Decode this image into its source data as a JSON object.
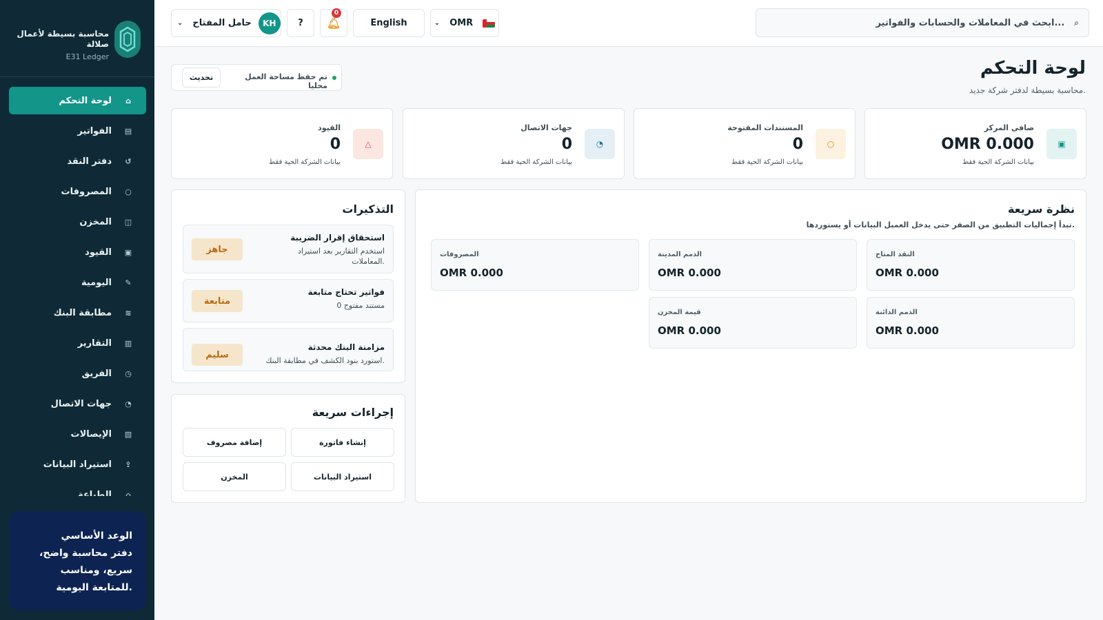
{
  "brand": {
    "name": "محاسبة بسيطة لأعمال صلالة",
    "product": "E31 Ledger"
  },
  "sidebar": {
    "items": [
      {
        "label": "لوحة التحكم",
        "icon": "home-icon",
        "glyph": "⌂"
      },
      {
        "label": "الفواتير",
        "icon": "invoice-icon",
        "glyph": "▤"
      },
      {
        "label": "دفتر النقد",
        "icon": "cash-icon",
        "glyph": "↺"
      },
      {
        "label": "المصروفات",
        "icon": "expense-icon",
        "glyph": "○"
      },
      {
        "label": "المخزن",
        "icon": "inventory-icon",
        "glyph": "◫"
      },
      {
        "label": "القيود",
        "icon": "entries-icon",
        "glyph": "▣"
      },
      {
        "label": "اليومية",
        "icon": "journal-icon",
        "glyph": "✎"
      },
      {
        "label": "مطابقة البنك",
        "icon": "bank-match-icon",
        "glyph": "≋"
      },
      {
        "label": "التقارير",
        "icon": "reports-icon",
        "glyph": "▥"
      },
      {
        "label": "الفريق",
        "icon": "team-icon",
        "glyph": "◷"
      },
      {
        "label": "جهات الاتصال",
        "icon": "contacts-icon",
        "glyph": "◔"
      },
      {
        "label": "الإيصالات",
        "icon": "receipts-icon",
        "glyph": "▧"
      },
      {
        "label": "استيراد البيانات",
        "icon": "import-icon",
        "glyph": "⇪"
      },
      {
        "label": "الطباعة",
        "icon": "print-icon",
        "glyph": "⌂"
      }
    ],
    "promise": {
      "title": "الوعد الأساسي",
      "text": "دفتر محاسبة واضح، سريع، ومناسب للمتابعة اليومية."
    }
  },
  "topbar": {
    "search_placeholder": "ابحث في المعاملات والحسابات والفواتير...",
    "currency": "OMR",
    "language": "English",
    "notifications_count": "0",
    "help": "?",
    "user_initials": "KH",
    "user_name": "حامل المفتاح"
  },
  "header": {
    "title": "لوحة التحكم",
    "subtitle": "محاسبة بسيطة لدفتر شركة جديد.",
    "saved_status": "تم حفظ مساحة العمل محليا",
    "refresh_label": "تحديث"
  },
  "kpis": [
    {
      "label": "صافي المركز",
      "value": "OMR 0.000",
      "foot": "بيانات الشركة الحية فقط",
      "icon": "balance-icon",
      "glyph": "▣",
      "color": "#13958a",
      "bg": "#e3f3f1"
    },
    {
      "label": "المستندات المفتوحة",
      "value": "0",
      "foot": "بيانات الشركة الحية فقط",
      "icon": "documents-icon",
      "glyph": "○",
      "color": "#e08a1e",
      "bg": "#fdf1e0"
    },
    {
      "label": "جهات الاتصال",
      "value": "0",
      "foot": "بيانات الشركة الحية فقط",
      "icon": "contacts-icon",
      "glyph": "◔",
      "color": "#1f6f9a",
      "bg": "#e4f0f6"
    },
    {
      "label": "القيود",
      "value": "0",
      "foot": "بيانات الشركة الحية فقط",
      "icon": "warning-icon",
      "glyph": "△",
      "color": "#d9503c",
      "bg": "#fbe6e2"
    }
  ],
  "quick_view": {
    "title": "نظرة سريعة",
    "subtitle": "تبدأ إجماليات التطبيق من الصفر حتى يدخل العميل البيانات أو يستوردها.",
    "items": [
      {
        "label": "النقد المتاح",
        "value": "OMR 0.000"
      },
      {
        "label": "الذمم المدينة",
        "value": "OMR 0.000"
      },
      {
        "label": "المصروفات",
        "value": "OMR 0.000"
      },
      {
        "label": "الذمم الدائنة",
        "value": "OMR 0.000"
      },
      {
        "label": "قيمة المخزن",
        "value": "OMR 0.000"
      }
    ]
  },
  "reminders": {
    "title": "التذكيرات",
    "items": [
      {
        "title": "استحقاق إقرار الضريبة",
        "subtitle": "استخدم التقارير بعد استيراد المعاملات.",
        "status": "جاهز"
      },
      {
        "title": "فواتير تحتاج متابعة",
        "subtitle": "0 مستند مفتوح",
        "status": "متابعة"
      },
      {
        "title": "مزامنة البنك محدثة",
        "subtitle": "استورد بنود الكشف في مطابقة البنك.",
        "status": "سليم"
      }
    ]
  },
  "quick_actions": {
    "title": "إجراءات سريعة",
    "items": [
      "إنشاء فاتورة",
      "إضافة مصروف",
      "استيراد البيانات",
      "المخزن"
    ]
  }
}
